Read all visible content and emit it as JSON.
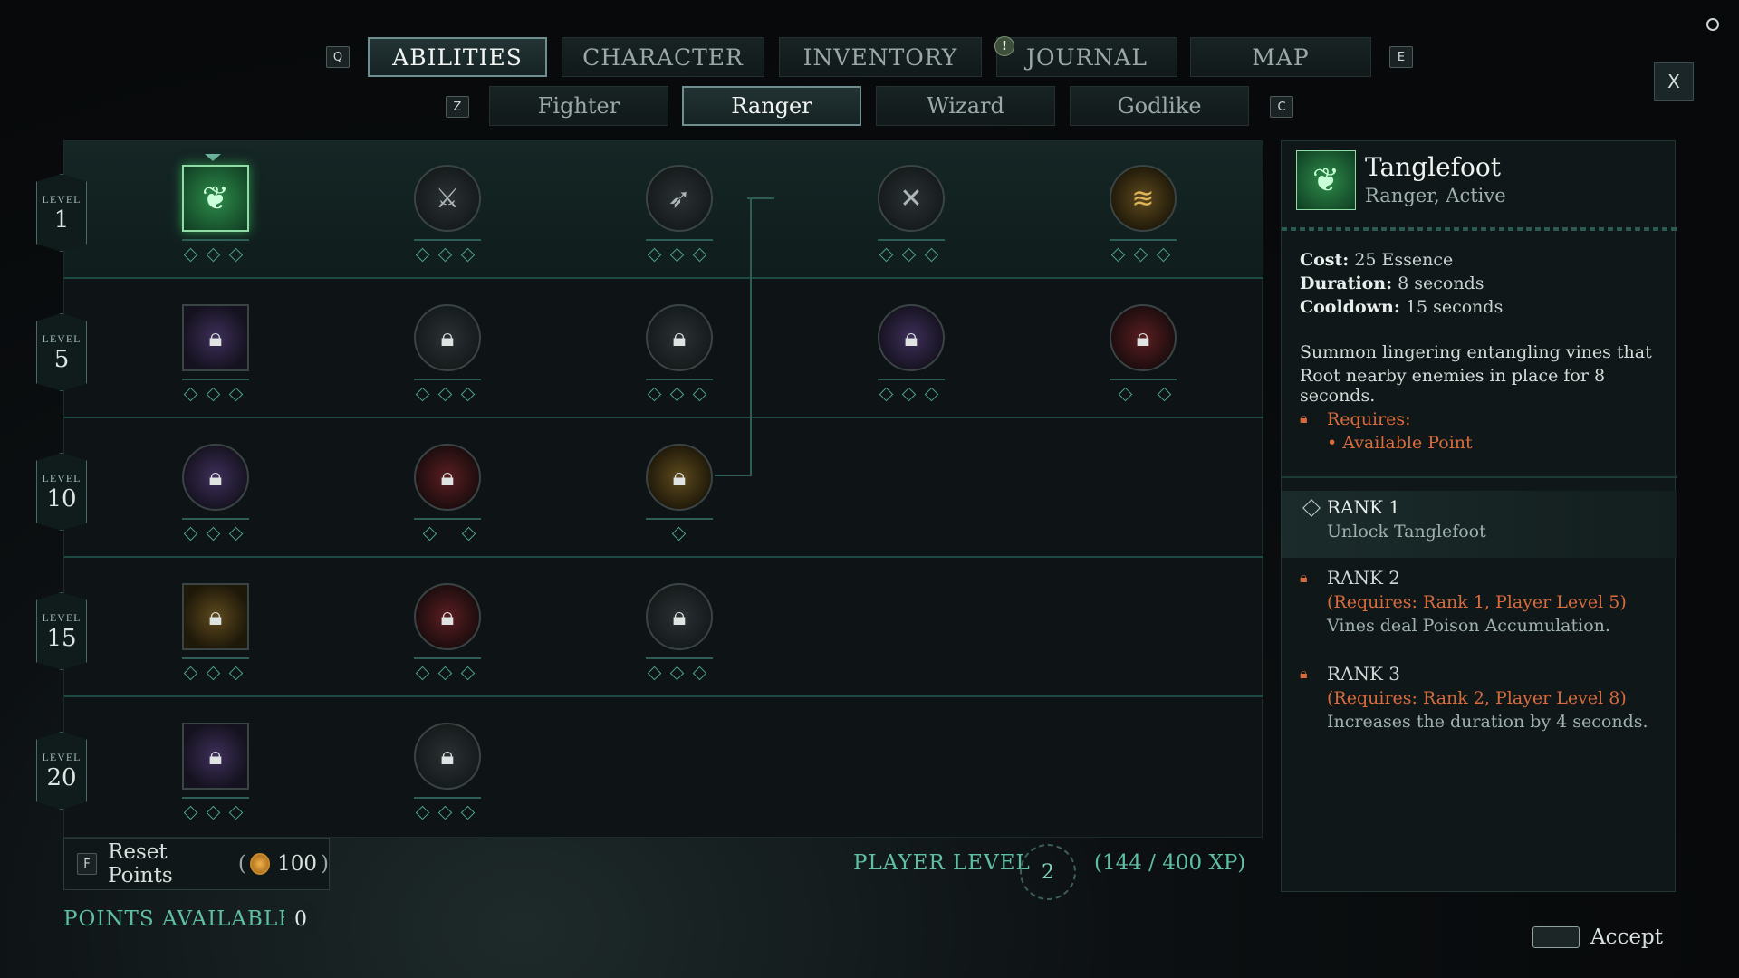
{
  "nav": {
    "left_key": "Q",
    "right_key": "E",
    "tabs": [
      "ABILITIES",
      "CHARACTER",
      "INVENTORY",
      "JOURNAL",
      "MAP"
    ],
    "journal_alert": "!"
  },
  "subnav": {
    "left_key": "Z",
    "right_key": "C",
    "tabs": [
      "Fighter",
      "Ranger",
      "Wizard",
      "Godlike"
    ]
  },
  "close_label": "X",
  "levels": [
    {
      "label": "LEVEL",
      "num": "1"
    },
    {
      "label": "LEVEL",
      "num": "5"
    },
    {
      "label": "LEVEL",
      "num": "10"
    },
    {
      "label": "LEVEL",
      "num": "15"
    },
    {
      "label": "LEVEL",
      "num": "20"
    }
  ],
  "footer": {
    "reset_key": "F",
    "reset_label": "Reset Points",
    "reset_open": "(",
    "reset_cost": "100",
    "reset_close": ")",
    "player_level_label": "PLAYER LEVEL",
    "player_level": "2",
    "xp_text": "(144 / 400 XP)",
    "points_label": "POINTS AVAILABLE",
    "points_value": "0",
    "accept_label": "Accept"
  },
  "detail": {
    "name": "Tanglefoot",
    "subtitle": "Ranger, Active",
    "cost_label": "Cost:",
    "cost_value": "25 Essence",
    "duration_label": "Duration:",
    "duration_value": "8 seconds",
    "cooldown_label": "Cooldown:",
    "cooldown_value": "15 seconds",
    "description_1": "Summon lingering entangling vines that",
    "description_2": "Root nearby enemies in place for 8 seconds.",
    "requires_label": "Requires:",
    "requires_item": "• Available Point",
    "ranks": [
      {
        "title": "RANK 1",
        "req": "",
        "effect": "Unlock Tanglefoot"
      },
      {
        "title": "RANK 2",
        "req": "(Requires: Rank 1, Player Level 5)",
        "effect": "Vines deal Poison Accumulation."
      },
      {
        "title": "RANK 3",
        "req": "(Requires: Rank 2, Player Level 8)",
        "effect": "Increases the duration by 4 seconds."
      }
    ]
  },
  "colors": {
    "accent": "#4fa38d",
    "requirement": "#d96b3c",
    "selected": "#2e8b4a"
  }
}
